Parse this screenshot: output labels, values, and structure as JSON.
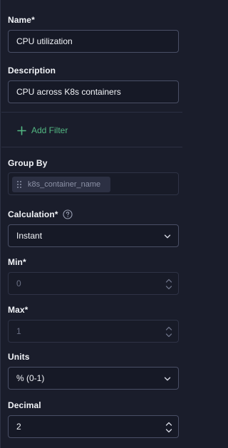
{
  "form": {
    "name": {
      "label": "Name*",
      "value": "CPU utilization"
    },
    "description": {
      "label": "Description",
      "value": "CPU across K8s containers"
    },
    "add_filter_label": "Add Filter",
    "group_by": {
      "label": "Group By",
      "chips": [
        "k8s_container_name"
      ]
    },
    "calculation": {
      "label": "Calculation*",
      "value": "Instant"
    },
    "min": {
      "label": "Min*",
      "placeholder": "0"
    },
    "max": {
      "label": "Max*",
      "placeholder": "1"
    },
    "units": {
      "label": "Units",
      "value": "% (0-1)"
    },
    "decimal": {
      "label": "Decimal",
      "value": "2"
    }
  },
  "colors": {
    "background": "#1a1d2b",
    "accent_green": "#53b883",
    "field_border": "#4a4f66"
  },
  "icons": {
    "add_filter": "plus-icon",
    "chip_handle": "drag-handle-icon",
    "help": "help-circle-icon",
    "select": "chevron-down-icon",
    "number": "stepper-icon"
  }
}
